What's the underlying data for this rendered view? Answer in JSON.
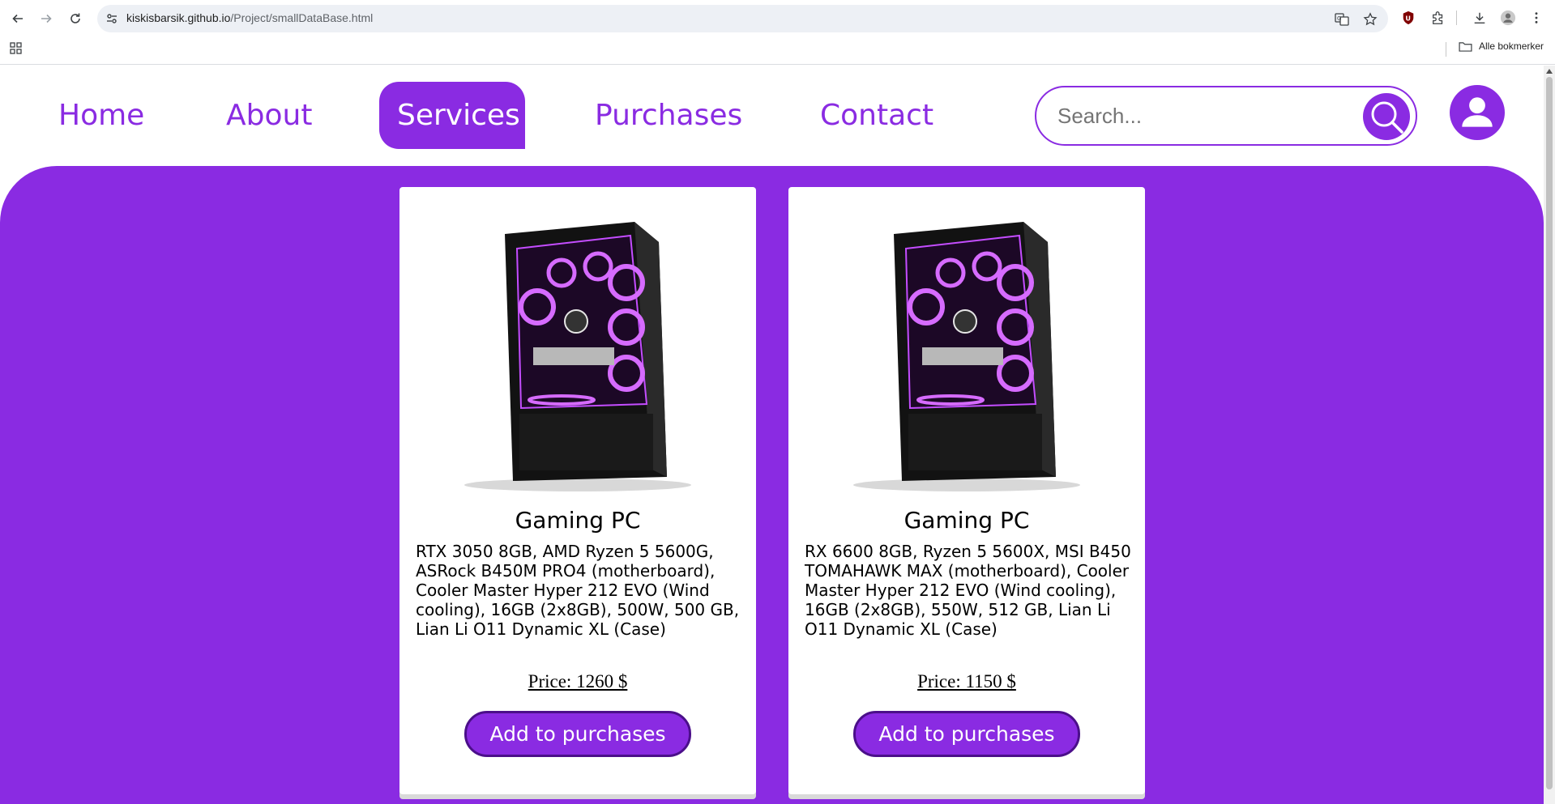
{
  "browser": {
    "url_host": "kiskisbarsik.github.io",
    "url_path": "/Project/smallDataBase.html",
    "bookmarks_label": "Alle bokmerker",
    "icons": [
      "back-icon",
      "forward-icon",
      "reload-icon",
      "site-info-icon",
      "translate-icon",
      "star-icon",
      "ublock-icon",
      "extensions-icon",
      "download-icon",
      "profile-icon",
      "menu-icon",
      "apps-icon",
      "folder-icon"
    ]
  },
  "nav": {
    "items": [
      {
        "label": "Home"
      },
      {
        "label": "About"
      },
      {
        "label": "Services",
        "active": true
      },
      {
        "label": "Purchases"
      },
      {
        "label": "Contact"
      }
    ],
    "search_placeholder": "Search...",
    "search_icon": "magnifier-icon",
    "user_icon": "user-icon"
  },
  "colors": {
    "accent": "#8a2be2",
    "button_border": "#4b0f8a",
    "card_bg": "#ffffff"
  },
  "products": [
    {
      "title": "Gaming PC",
      "description": "RTX 3050 8GB, AMD Ryzen 5 5600G, ASRock B450M PRO4 (motherboard), Cooler Master Hyper 212 EVO (Wind cooling), 16GB (2x8GB), 500W, 500 GB, Lian Li O11 Dynamic XL (Case)",
      "price": "Price: 1260 $",
      "button": "Add to purchases"
    },
    {
      "title": "Gaming PC",
      "description": "RX 6600 8GB, Ryzen 5 5600X, MSI B450 TOMAHAWK MAX (motherboard), Cooler Master Hyper 212 EVO (Wind cooling), 16GB (2x8GB), 550W, 512 GB, Lian Li O11 Dynamic XL (Case)",
      "price": "Price: 1150 $",
      "button": "Add to purchases"
    }
  ]
}
